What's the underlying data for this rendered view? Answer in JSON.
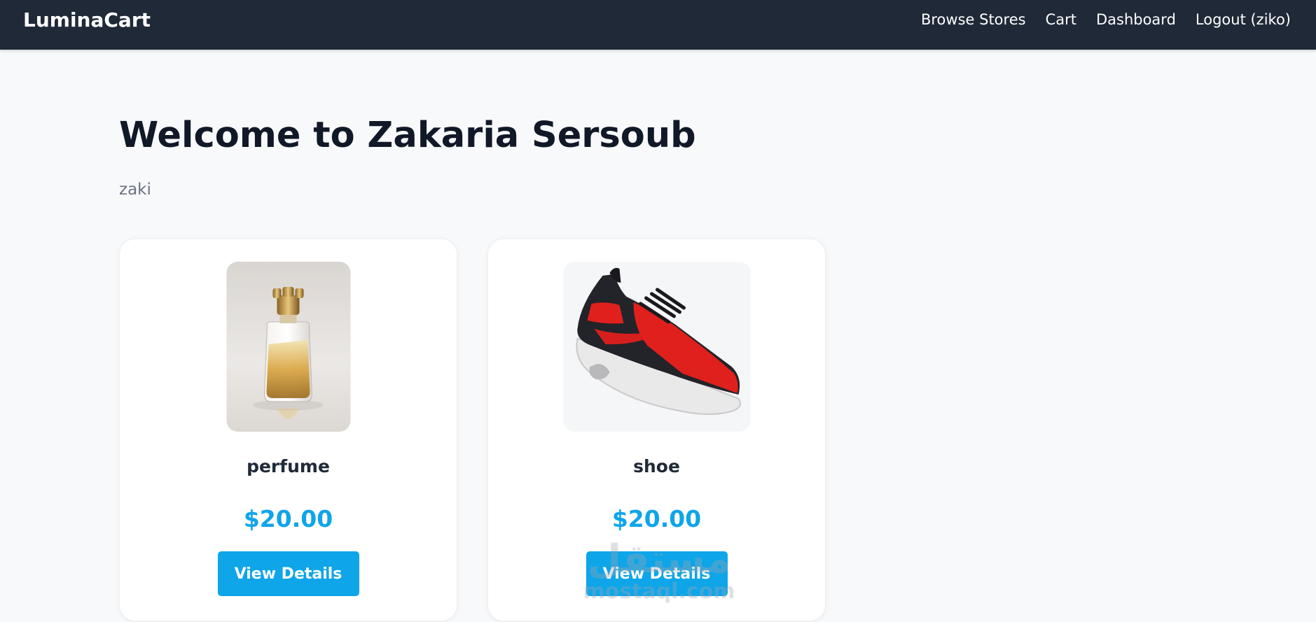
{
  "navbar": {
    "brand": "LuminaCart",
    "links": [
      {
        "label": "Browse Stores"
      },
      {
        "label": "Cart"
      },
      {
        "label": "Dashboard"
      },
      {
        "label": "Logout (ziko)"
      }
    ]
  },
  "store": {
    "welcome": "Welcome to Zakaria Sersoub",
    "description": "zaki"
  },
  "products": [
    {
      "name": "perfume",
      "price": "$20.00",
      "button": "View Details",
      "image": "perfume-bottle"
    },
    {
      "name": "shoe",
      "price": "$20.00",
      "button": "View Details",
      "image": "red-sneaker"
    }
  ],
  "watermark": {
    "arabic": "مستقل",
    "latin": "mostaql.com"
  },
  "colors": {
    "navbar": "#1f2937",
    "accent": "#0ea5e9",
    "background": "#f8f9fb"
  }
}
